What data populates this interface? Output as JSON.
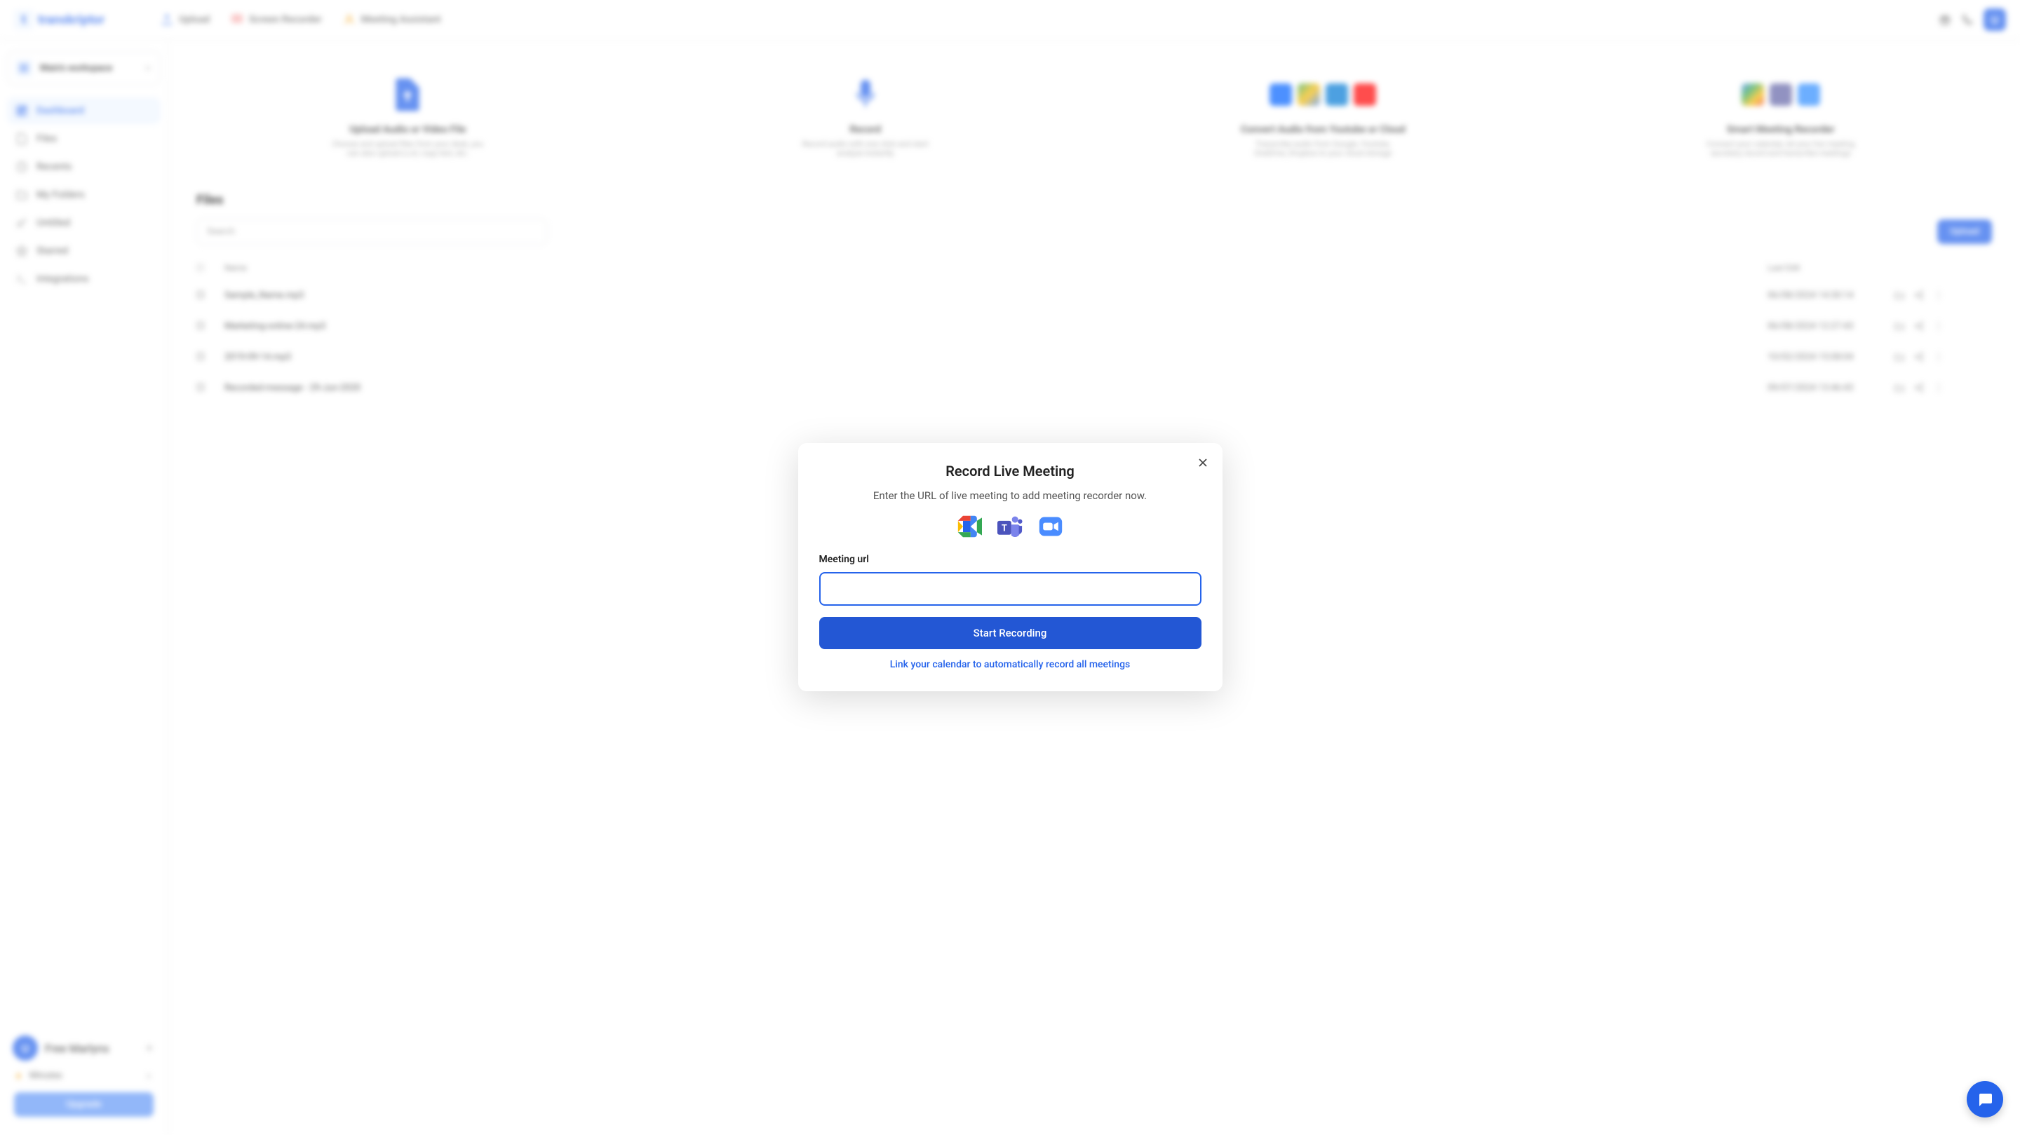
{
  "brand": "transkriptor",
  "top_tabs": {
    "upload": "Upload",
    "screen": "Screen Recorder",
    "assistant": "Meeting Assistant"
  },
  "workspace": "Main's workspace",
  "nav": {
    "dashboard": "Dashboard",
    "files": "Files",
    "recents": "Recents",
    "myfolders": "My Folders",
    "untitled": "Untitled",
    "starred": "Starred",
    "integrations": "Integrations"
  },
  "user_name": "Free Marlyns",
  "minutes_label": "Minutes",
  "upgrade": "Upgrade",
  "cards": {
    "upload": {
      "title": "Upload Audio or Video File",
      "desc": "Choose and upload files from your desk, you can also upload a url, copy text, etc."
    },
    "record": {
      "title": "Record",
      "desc": "Record audio with one click and start analyze instantly"
    },
    "convert": {
      "title": "Convert Audio from Youtube or Cloud",
      "desc": "Transcribe audio from Google, Youtube, OneDrive, Dropbox to your cloud storage"
    },
    "smart": {
      "title": "Smart Meeting Recorder",
      "desc": "Connect your calendar, let your live meeting secretary record and transcribe meetings"
    }
  },
  "files": {
    "heading": "Files",
    "search_placeholder": "Search",
    "upload_btn": "Upload",
    "cols": {
      "name": "Name",
      "date": "Last Edit"
    },
    "rows": [
      {
        "name": "Sample_Name.mp3",
        "date": "06/08/2024 14:30:14"
      },
      {
        "name": "Marketing-online-24.mp3",
        "date": "06/08/2024 12:27:43"
      },
      {
        "name": "2019-09-14.mp3",
        "date": "10/02/2024 15:08:04"
      },
      {
        "name": "Recorded-message - 29-Jun-2020",
        "date": "09/07/2024 13:46:43"
      }
    ]
  },
  "modal": {
    "title": "Record Live Meeting",
    "subtitle": "Enter the URL of live meeting to add meeting recorder now.",
    "field_label": "Meeting url",
    "start": "Start Recording",
    "link": "Link your calendar to automatically record all meetings"
  }
}
